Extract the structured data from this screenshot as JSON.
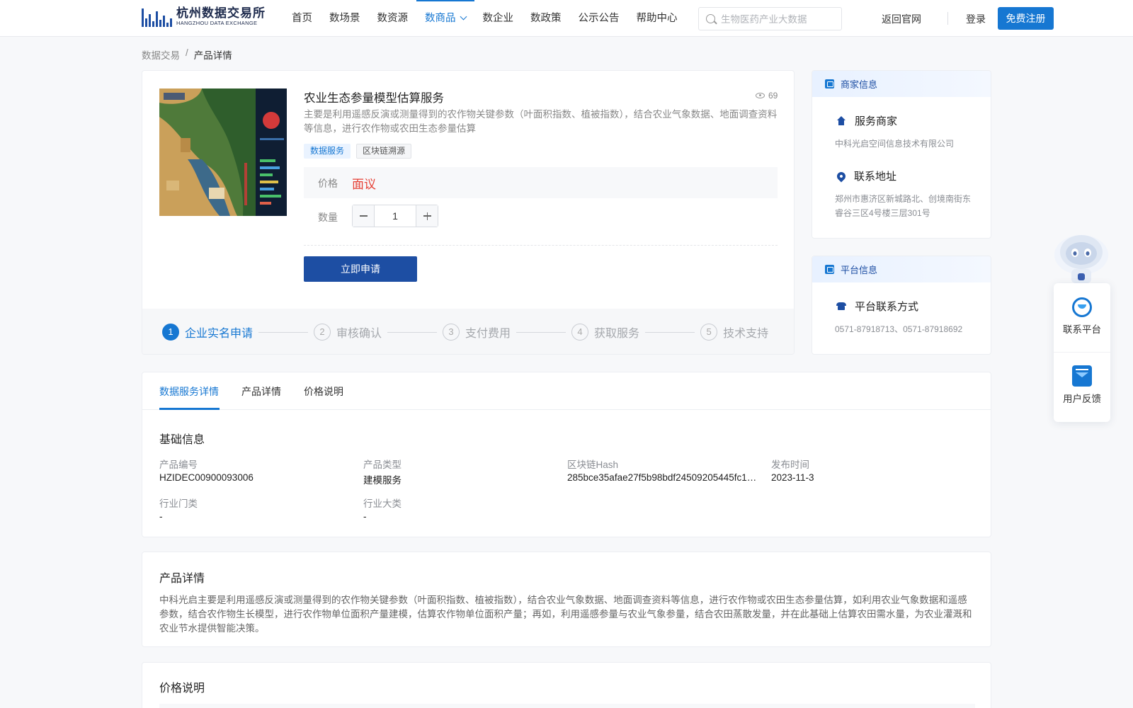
{
  "header": {
    "logo_cn": "杭州数据交易所",
    "logo_en": "HANGZHOU DATA EXCHANGE",
    "nav": [
      {
        "label": "首页"
      },
      {
        "label": "数场景"
      },
      {
        "label": "数资源"
      },
      {
        "label": "数商品",
        "active": true
      },
      {
        "label": "数企业"
      },
      {
        "label": "数政策"
      },
      {
        "label": "公示公告"
      },
      {
        "label": "帮助中心"
      }
    ],
    "search_placeholder": "生物医药产业大数据",
    "back_link": "返回官网",
    "login": "登录",
    "register": "免费注册",
    "accent_color": "#1677d2"
  },
  "breadcrumb": {
    "root": "数据交易",
    "separator": "/",
    "current": "产品详情"
  },
  "product": {
    "title": "农业生态参量模型估算服务",
    "views": "69",
    "description": "主要是利用遥感反演或测量得到的农作物关键参数（叶面积指数、植被指数），结合农业气象数据、地面调查资料等信息，进行农作物或农田生态参量估算",
    "tags": [
      "数据服务",
      "区块链溯源"
    ],
    "price_label": "价格",
    "price_value": "面议",
    "price_color": "#e64035",
    "quantity_label": "数量",
    "quantity": "1",
    "apply_button": "立即申请"
  },
  "steps": [
    {
      "num": "1",
      "label": "企业实名申请",
      "active": true
    },
    {
      "num": "2",
      "label": "审核确认"
    },
    {
      "num": "3",
      "label": "支付费用"
    },
    {
      "num": "4",
      "label": "获取服务"
    },
    {
      "num": "5",
      "label": "技术支持"
    }
  ],
  "merchant": {
    "heading": "商家信息",
    "service_title": "服务商家",
    "service_name": "中科光启空间信息技术有限公司",
    "address_title": "联系地址",
    "address": "郑州市惠济区新城路北、创境南街东睿谷三区4号楼三层301号"
  },
  "platform": {
    "heading": "平台信息",
    "contact_title": "平台联系方式",
    "phones": "0571-87918713、0571-87918692"
  },
  "float": {
    "contact": "联系平台",
    "feedback": "用户反馈"
  },
  "detail_tabs": [
    "数据服务详情",
    "产品详情",
    "价格说明"
  ],
  "basic_info": {
    "title": "基础信息",
    "fields": [
      {
        "label": "产品编号",
        "value": "HZIDEC00900093006"
      },
      {
        "label": "产品类型",
        "value": "建模服务"
      },
      {
        "label": "区块链Hash",
        "value": "285bce35afae27f5b98bdf24509205445fc1…"
      },
      {
        "label": "发布时间",
        "value": "2023-11-3"
      },
      {
        "label": "行业门类",
        "value": "-"
      },
      {
        "label": "行业大类",
        "value": "-"
      }
    ]
  },
  "product_detail": {
    "title": "产品详情",
    "text": "中科光启主要是利用遥感反演或测量得到的农作物关键参数（叶面积指数、植被指数），结合农业气象数据、地面调查资料等信息，进行农作物或农田生态参量估算，如利用农业气象数据和遥感参数，结合农作物生长模型，进行农作物单位面积产量建模，估算农作物单位面积产量；再如，利用遥感参量与农业气象参量，结合农田蒸散发量，并在此基础上估算农田需水量，为农业灌溉和农业节水提供智能决策。"
  },
  "price_note": {
    "title": "价格说明"
  }
}
